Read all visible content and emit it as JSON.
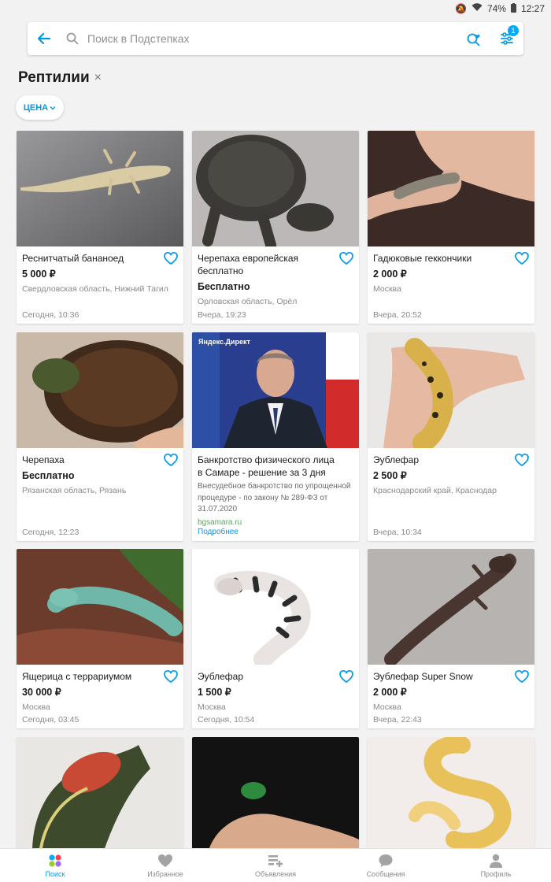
{
  "status": {
    "battery": "74%",
    "time": "12:27"
  },
  "search": {
    "placeholder": "Поиск в Подстепках",
    "filters_count": "1"
  },
  "category": {
    "title": "Рептилии",
    "remove": "×"
  },
  "filters": {
    "price_label": "ЦЕНА"
  },
  "listings": [
    {
      "title": "Реснитчатый бананоед",
      "price": "5 000 ₽",
      "location": "Свердловская область, Нижний Тагил",
      "date": "Сегодня, 10:36",
      "image": "gecko-photo"
    },
    {
      "title": "Черепаха европейская бесплатно",
      "price": "Бесплатно",
      "location": "Орловская область, Орёл",
      "date": "Вчера, 19:23",
      "image": "turtle-photo"
    },
    {
      "title": "Гадюковые геккончики",
      "price": "2 000 ₽",
      "location": "Москва",
      "date": "Вчера, 20:52",
      "image": "gecko-hand-photo"
    },
    {
      "title": "Черепаха",
      "price": "Бесплатно",
      "location": "Рязанская область, Рязань",
      "date": "Сегодня, 12:23",
      "image": "turtle-hand-photo"
    },
    {
      "title": "Эублефар",
      "price": "2 500 ₽",
      "location": "Краснодарский край, Краснодар",
      "date": "Вчера, 10:34",
      "image": "leopard-gecko-photo"
    },
    {
      "title": "Ящерица с террариумом",
      "price": "30 000 ₽",
      "location": "Москва",
      "date": "Сегодня, 03:45",
      "image": "iguana-photo"
    },
    {
      "title": "Эублефар",
      "price": "1 500 ₽",
      "location": "Москва",
      "date": "Сегодня, 10:54",
      "image": "eublefar-white-photo"
    },
    {
      "title": "Эублефар Super Snow",
      "price": "2 000 ₽",
      "location": "Москва",
      "date": "Вчера, 22:43",
      "image": "dark-gecko-photo"
    },
    {
      "title": "",
      "price": "",
      "location": "",
      "date": "",
      "image": "red-ear-turtle-photo"
    },
    {
      "title": "",
      "price": "",
      "location": "",
      "date": "",
      "image": "small-turtle-photo"
    },
    {
      "title": "",
      "price": "",
      "location": "",
      "date": "",
      "image": "python-photo"
    }
  ],
  "ad": {
    "label": "Яндекс.Директ",
    "title": "Банкротство физического лица в Самаре - решение за 3 дня",
    "description": "Внесудебное банкротство по упрощенной процедуре - по закону № 289-ФЗ от 31.07.2020",
    "domain": "bgsamara.ru",
    "more": "Подробнее"
  },
  "nav": [
    {
      "label": "Поиск",
      "icon": "search-tab-icon",
      "active": true
    },
    {
      "label": "Избранное",
      "icon": "heart-icon"
    },
    {
      "label": "Объявления",
      "icon": "add-listing-icon"
    },
    {
      "label": "Сообщения",
      "icon": "chat-icon"
    },
    {
      "label": "Профиль",
      "icon": "profile-icon"
    }
  ],
  "colors": {
    "accent": "#0099e6",
    "background": "#f2f2f2"
  }
}
